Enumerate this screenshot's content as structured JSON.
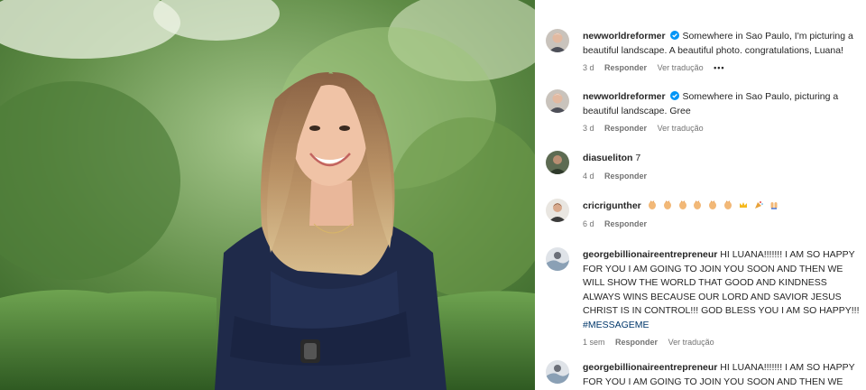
{
  "comments": [
    {
      "username": "newworldreformer",
      "verified": true,
      "text": "Somewhere in Sao Paulo, I'm picturing a beautiful landscape. A beautiful photo. congratulations, Luana!",
      "time": "3 d",
      "reply_label": "Responder",
      "translate_label": "Ver tradução",
      "more_label": "•••"
    },
    {
      "username": "newworldreformer",
      "verified": true,
      "text": "Somewhere in Sao Paulo, picturing a beautiful landscape. Gree",
      "time": "3 d",
      "reply_label": "Responder",
      "translate_label": "Ver tradução"
    },
    {
      "username": "diasueliton",
      "text": "7",
      "time": "4 d",
      "reply_label": "Responder"
    },
    {
      "username": "cricrigunther",
      "emoji": [
        "clapping-hands",
        "clapping-hands",
        "clapping-hands",
        "clapping-hands",
        "clapping-hands",
        "clapping-hands",
        "crown",
        "party-popper",
        "raising-hands"
      ],
      "time": "6 d",
      "reply_label": "Responder"
    },
    {
      "username": "georgebillionaireentrepreneur",
      "text": "HI LUANA!!!!!!! I AM SO HAPPY FOR YOU I AM GOING TO JOIN YOU SOON AND THEN WE WILL SHOW THE WORLD THAT GOOD AND KINDNESS ALWAYS WINS BECAUSE OUR LORD AND SAVIOR JESUS CHRIST IS IN CONTROL!!! GOD BLESS YOU I AM SO HAPPY!!!",
      "hashtag": "#MESSAGEME",
      "time": "1 sem",
      "reply_label": "Responder",
      "translate_label": "Ver tradução"
    },
    {
      "username": "georgebillionaireentrepreneur",
      "text": "HI LUANA!!!!!!! I AM SO HAPPY FOR YOU I AM GOING TO JOIN YOU SOON AND THEN WE"
    }
  ],
  "colors": {
    "verified": "#0095f6",
    "hashtag": "#00376b",
    "meta": "#737373"
  }
}
